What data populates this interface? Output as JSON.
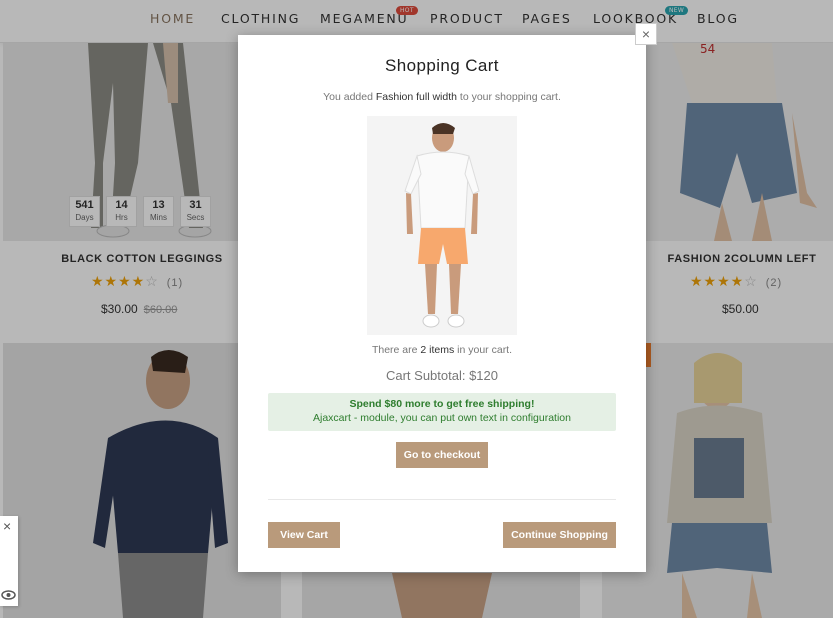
{
  "nav": {
    "items": [
      "HOME",
      "CLOTHING",
      "MEGAMENU",
      "PRODUCT",
      "PAGES",
      "LOOKBOOK",
      "BLOG"
    ],
    "badges": {
      "hot": "HOT",
      "new": "NEW"
    },
    "hot_color": "#e04b3c",
    "new_color": "#2aa6b0"
  },
  "products": [
    {
      "title": "BLACK COTTON LEGGINGS",
      "rating_count": "(1)",
      "price": "$30.00",
      "old_price": "$60.00",
      "stars": 4
    },
    {
      "title": "FASHION 2COLUMN LEFT",
      "rating_count": "(2)",
      "price": "$50.00",
      "stars": 4
    }
  ],
  "countdown": [
    {
      "value": "541",
      "label": "Days"
    },
    {
      "value": "14",
      "label": "Hrs"
    },
    {
      "value": "13",
      "label": "Mins"
    },
    {
      "value": "31",
      "label": "Secs"
    }
  ],
  "modal": {
    "title": "Shopping Cart",
    "added_prefix": "You added ",
    "added_product": "Fashion full width",
    "added_suffix": " to your shopping cart.",
    "items_prefix": "There are ",
    "items_count": "2 items",
    "items_suffix": " in your cart.",
    "subtotal": "Cart Subtotal: $120",
    "shipping_line1": "Spend $80 more to get free shipping!",
    "shipping_line2": "Ajaxcart - module, you can put own text in configuration",
    "checkout_label": "Go to checkout",
    "view_cart_label": "View Cart",
    "continue_label": "Continue Shopping",
    "close_symbol": "×"
  },
  "side_tab": {
    "close_symbol": "×",
    "icon": "eye-icon"
  },
  "colors": {
    "accent": "#b99a7b",
    "star": "#f0a30a",
    "ship_bg": "#e5f0e5",
    "ship_text": "#2e7d2e"
  }
}
